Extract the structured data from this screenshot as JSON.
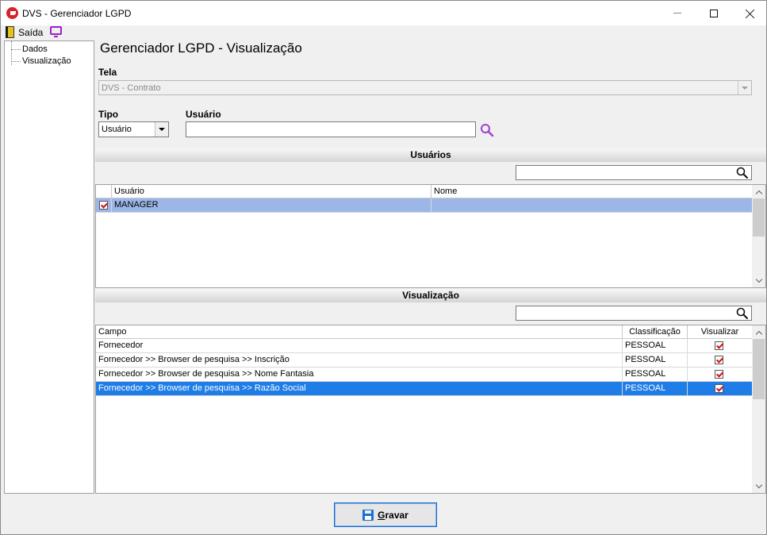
{
  "window": {
    "title": "DVS - Gerenciador LGPD"
  },
  "toolbar": {
    "exit_label": "Saída"
  },
  "tree": {
    "items": [
      {
        "label": "Dados"
      },
      {
        "label": "Visualização"
      }
    ]
  },
  "page": {
    "title": "Gerenciador LGPD - Visualização"
  },
  "tela": {
    "label": "Tela",
    "value": "DVS - Contrato"
  },
  "tipo": {
    "label": "Tipo",
    "value": "Usuário"
  },
  "usuario": {
    "label": "Usuário",
    "value": ""
  },
  "usuarios_section": {
    "title": "Usuários",
    "filter_value": "",
    "columns": [
      "Usuário",
      "Nome"
    ],
    "rows": [
      {
        "usuario": "MANAGER",
        "nome": "",
        "checked": true
      }
    ]
  },
  "visualizacao_section": {
    "title": "Visualização",
    "filter_value": "",
    "columns": [
      "Campo",
      "Classificação",
      "Visualizar"
    ],
    "rows": [
      {
        "campo": "Fornecedor",
        "classificacao": "PESSOAL",
        "visualizar": true
      },
      {
        "campo": "Fornecedor >> Browser de pesquisa >> Inscrição",
        "classificacao": "PESSOAL",
        "visualizar": true
      },
      {
        "campo": "Fornecedor >> Browser de pesquisa >> Nome Fantasia",
        "classificacao": "PESSOAL",
        "visualizar": true
      },
      {
        "campo": "Fornecedor >> Browser de pesquisa >> Razão Social",
        "classificacao": "PESSOAL",
        "visualizar": true
      }
    ]
  },
  "footer": {
    "save_first_letter": "G",
    "save_rest": "ravar"
  },
  "colors": {
    "selection": "#1e7de6",
    "selection_user": "#9db6e8",
    "accent_purple": "#9b22c7",
    "check_red": "#d0101a"
  }
}
